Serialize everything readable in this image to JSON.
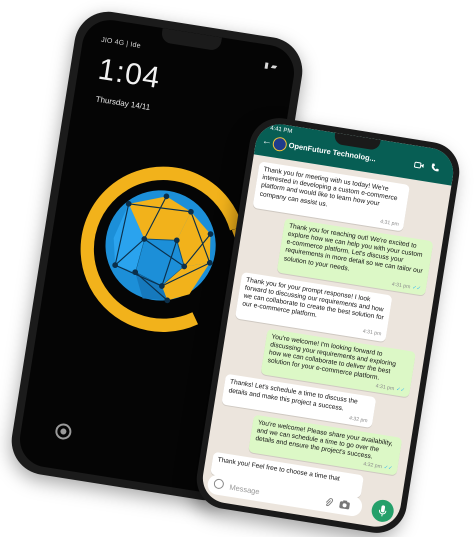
{
  "lock_screen": {
    "status_left": "JIO 4G | Ide",
    "time": "1:04",
    "date": "Thursday 14/11"
  },
  "chat": {
    "status_time": "4:41 PM",
    "contact_name": "OpenFuture Technolog...",
    "input_placeholder": "Message",
    "messages": [
      {
        "dir": "in",
        "text": "Thank you for meeting with us today! We're interested in developing a custom e-commerce platform and would like to learn how your company can assist us.",
        "time": "4:31 pm"
      },
      {
        "dir": "out",
        "text": "Thank you for reaching out! We're excited to explore how we can help you with your custom e-commerce platform. Let's discuss your requirements in more detail so we can tailor our solution to your needs.",
        "time": "4:31 pm"
      },
      {
        "dir": "in",
        "text": "Thank you for your prompt response! I look forward to discussing our requirements and how we can collaborate to create the best solution for our e-commerce platform.",
        "time": "4:31 pm"
      },
      {
        "dir": "out",
        "text": "You're welcome! I'm looking forward to discussing your requirements and exploring how we can collaborate to deliver the best solution for your e-commerce platform.",
        "time": "4:31 pm"
      },
      {
        "dir": "in",
        "text": "Thanks! Let's schedule a time to discuss the details and make this project a success.",
        "time": "4:32 pm"
      },
      {
        "dir": "out",
        "text": "You're welcome! Please share your availability, and we can schedule a time to go over the details and ensure the project's success.",
        "time": "4:32 pm"
      },
      {
        "dir": "in",
        "text": "Thank you! Feel free to choose a time that",
        "time": ""
      }
    ]
  },
  "colors": {
    "header_green": "#075e54",
    "outgoing_bubble": "#dcf8c6",
    "chat_background": "#ece5dd",
    "logo_blue": "#1c8fd8",
    "logo_gold": "#f2b21b",
    "mic_green": "#25a06a"
  },
  "icons": [
    "back-arrow-icon",
    "video-call-icon",
    "phone-call-icon",
    "emoji-icon",
    "attach-icon",
    "camera-icon",
    "mic-icon",
    "fingerprint-icon"
  ]
}
